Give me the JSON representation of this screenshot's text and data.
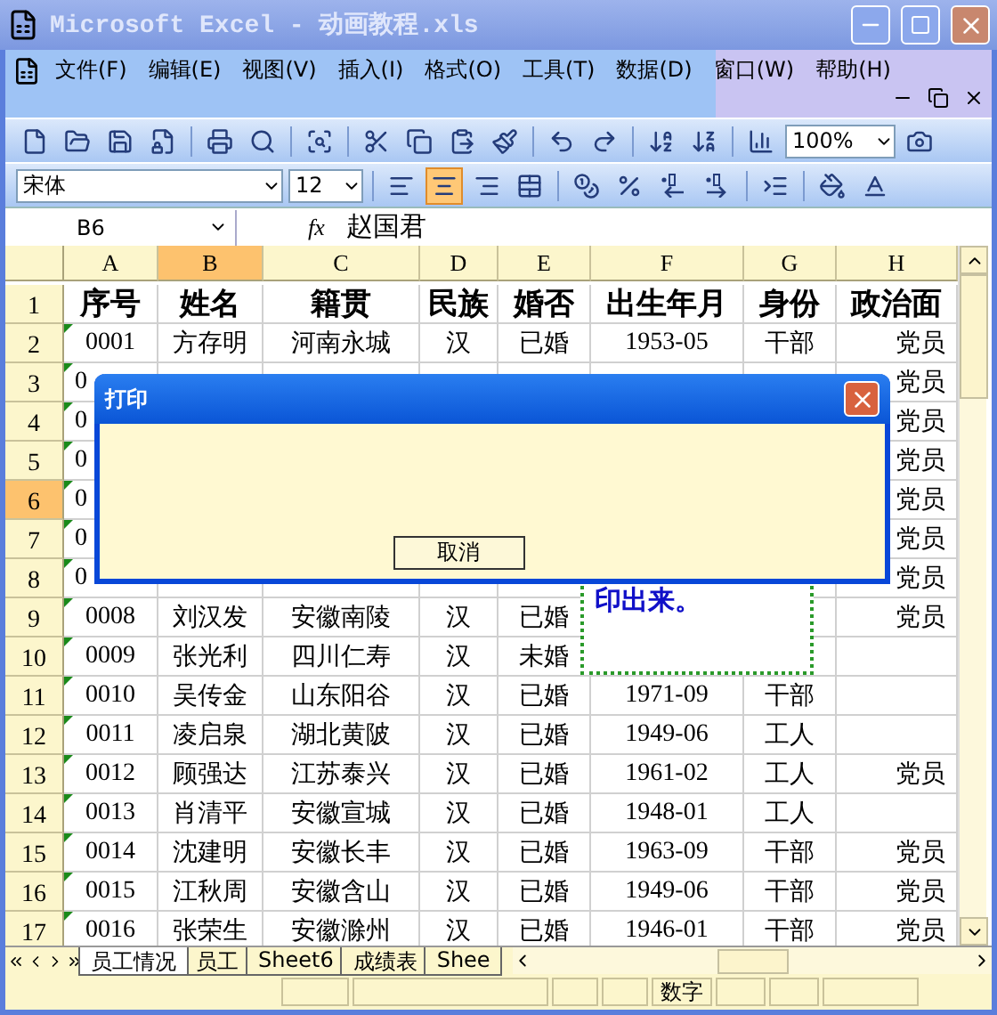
{
  "window": {
    "title": "Microsoft Excel - 动画教程.xls"
  },
  "menu": [
    "文件(F)",
    "编辑(E)",
    "视图(V)",
    "插入(I)",
    "格式(O)",
    "工具(T)",
    "数据(D)",
    "窗口(W)",
    "帮助(H)"
  ],
  "standard_toolbar": {
    "zoom": "100%"
  },
  "formatting_toolbar": {
    "font": "宋体",
    "size": "12",
    "align_buttons": [
      {
        "kind": "left",
        "selected": false
      },
      {
        "kind": "center",
        "selected": true
      },
      {
        "kind": "right",
        "selected": false
      }
    ]
  },
  "formula_bar": {
    "name_box": "B6",
    "function_label": "fx",
    "value": "赵国君"
  },
  "columns": [
    {
      "label": "A",
      "selected": false
    },
    {
      "label": "B",
      "selected": true
    },
    {
      "label": "C",
      "selected": false
    },
    {
      "label": "D",
      "selected": false
    },
    {
      "label": "E",
      "selected": false
    },
    {
      "label": "F",
      "selected": false
    },
    {
      "label": "G",
      "selected": false
    },
    {
      "label": "H",
      "selected": false
    }
  ],
  "rows": [
    {
      "header": "1",
      "kind": "heading",
      "selected": false,
      "cells": [
        "序号",
        "姓名",
        "籍贯",
        "民族",
        "婚否",
        "出生年月",
        "身份",
        "政治面"
      ]
    },
    {
      "header": "2",
      "kind": "data",
      "selected": false,
      "flag": true,
      "cells": [
        "0001",
        "方存明",
        "河南永城",
        "汉",
        "已婚",
        "1953-05",
        "干部",
        "党员"
      ]
    },
    {
      "header": "3",
      "kind": "covered",
      "selected": false,
      "flag": true,
      "cells": [
        "0",
        null,
        null,
        null,
        null,
        null,
        null,
        "党员"
      ]
    },
    {
      "header": "4",
      "kind": "covered",
      "selected": false,
      "flag": true,
      "cells": [
        "0",
        null,
        null,
        null,
        null,
        null,
        null,
        "党员"
      ]
    },
    {
      "header": "5",
      "kind": "covered",
      "selected": false,
      "flag": true,
      "cells": [
        "0",
        null,
        null,
        null,
        null,
        null,
        null,
        "党员"
      ]
    },
    {
      "header": "6",
      "kind": "covered",
      "selected": true,
      "flag": true,
      "cells": [
        "0",
        null,
        null,
        null,
        null,
        null,
        null,
        "党员"
      ]
    },
    {
      "header": "7",
      "kind": "covered",
      "selected": false,
      "flag": true,
      "cells": [
        "0",
        null,
        null,
        null,
        null,
        null,
        null,
        "党员"
      ]
    },
    {
      "header": "8",
      "kind": "covered",
      "selected": false,
      "flag": true,
      "cells": [
        "0",
        null,
        null,
        null,
        null,
        null,
        null,
        "党员"
      ]
    },
    {
      "header": "9",
      "kind": "data",
      "selected": false,
      "flag": true,
      "cells": [
        "0008",
        "刘汉发",
        "安徽南陵",
        "汉",
        "已婚",
        null,
        null,
        "党员"
      ]
    },
    {
      "header": "10",
      "kind": "data",
      "selected": false,
      "flag": true,
      "cells": [
        "0009",
        "张光利",
        "四川仁寿",
        "汉",
        "未婚",
        null,
        null,
        null
      ]
    },
    {
      "header": "11",
      "kind": "data",
      "selected": false,
      "flag": true,
      "cells": [
        "0010",
        "吴传金",
        "山东阳谷",
        "汉",
        "已婚",
        "1971-09",
        "干部",
        null
      ]
    },
    {
      "header": "12",
      "kind": "data",
      "selected": false,
      "flag": true,
      "cells": [
        "0011",
        "凌启泉",
        "湖北黄陂",
        "汉",
        "已婚",
        "1949-06",
        "工人",
        null
      ]
    },
    {
      "header": "13",
      "kind": "data",
      "selected": false,
      "flag": true,
      "cells": [
        "0012",
        "顾强达",
        "江苏泰兴",
        "汉",
        "已婚",
        "1961-02",
        "工人",
        "党员"
      ]
    },
    {
      "header": "14",
      "kind": "data",
      "selected": false,
      "flag": true,
      "cells": [
        "0013",
        "肖清平",
        "安徽宣城",
        "汉",
        "已婚",
        "1948-01",
        "工人",
        null
      ]
    },
    {
      "header": "15",
      "kind": "data",
      "selected": false,
      "flag": true,
      "cells": [
        "0014",
        "沈建明",
        "安徽长丰",
        "汉",
        "已婚",
        "1963-09",
        "干部",
        "党员"
      ]
    },
    {
      "header": "16",
      "kind": "data",
      "selected": false,
      "flag": true,
      "cells": [
        "0015",
        "江秋周",
        "安徽含山",
        "汉",
        "已婚",
        "1949-06",
        "干部",
        "党员"
      ]
    },
    {
      "header": "17",
      "kind": "data",
      "selected": false,
      "flag": true,
      "cells": [
        "0016",
        "张荣生",
        "安徽滁州",
        "汉",
        "已婚",
        "1946-01",
        "干部",
        "党员"
      ]
    }
  ],
  "text_box": {
    "text": "印出来。"
  },
  "dialog": {
    "title": "打印",
    "button": "取消"
  },
  "sheet_tabs": [
    {
      "label": "员工情况",
      "selected": true
    },
    {
      "label": "员工",
      "selected": false
    },
    {
      "label": "Sheet6",
      "selected": false
    },
    {
      "label": "成绩表",
      "selected": false
    },
    {
      "label": "Shee",
      "selected": false
    }
  ],
  "status_bar": {
    "mode": "数字"
  }
}
